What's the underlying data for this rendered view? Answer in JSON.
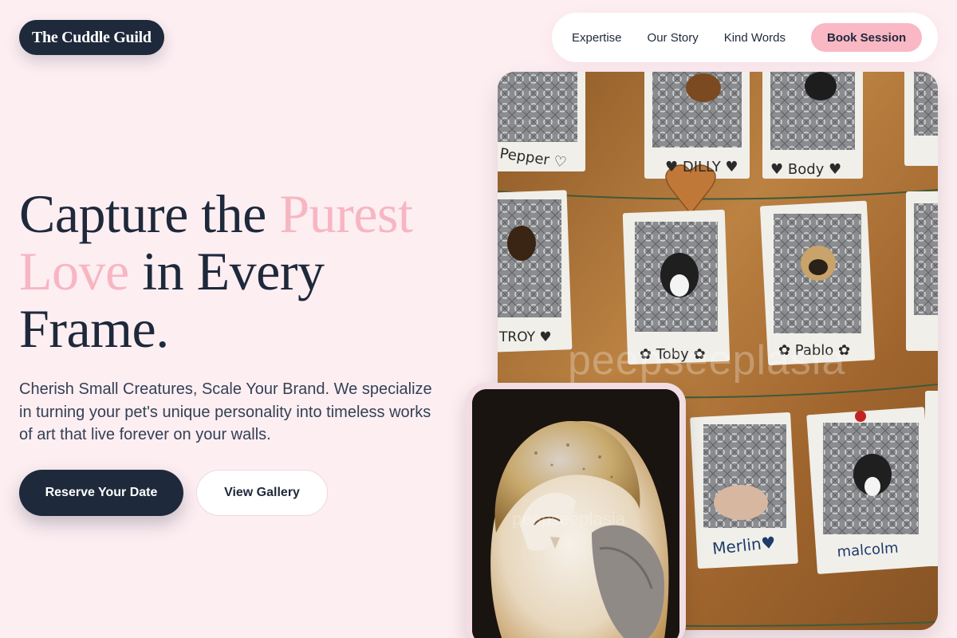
{
  "header": {
    "logo": "The Cuddle Guild",
    "nav": [
      {
        "label": "Expertise"
      },
      {
        "label": "Our Story"
      },
      {
        "label": "Kind Words"
      }
    ],
    "cta_label": "Book Session"
  },
  "hero": {
    "headline_part1": "Capture the ",
    "headline_accent1": "Purest",
    "headline_accent2": "Love",
    "headline_part2": " in Every",
    "headline_part3": "Frame.",
    "subtext": "Cherish Small Creatures, Scale Your Brand. We specialize in turning your pet's unique personality into timeless works of art that live forever on your walls.",
    "primary_button": "Reserve Your Date",
    "secondary_button": "View Gallery"
  },
  "gallery": {
    "watermark": "peepseeplasia",
    "owl_watermark": "peepseeplasia",
    "polaroid_names": [
      "Pepper",
      "DILLY",
      "Body",
      "TROY",
      "Toby",
      "Pablo",
      "Merlin",
      "malcolm"
    ]
  },
  "colors": {
    "accent_pink": "#f7b6c2",
    "navy": "#1e293b",
    "background": "#fdeef2"
  }
}
